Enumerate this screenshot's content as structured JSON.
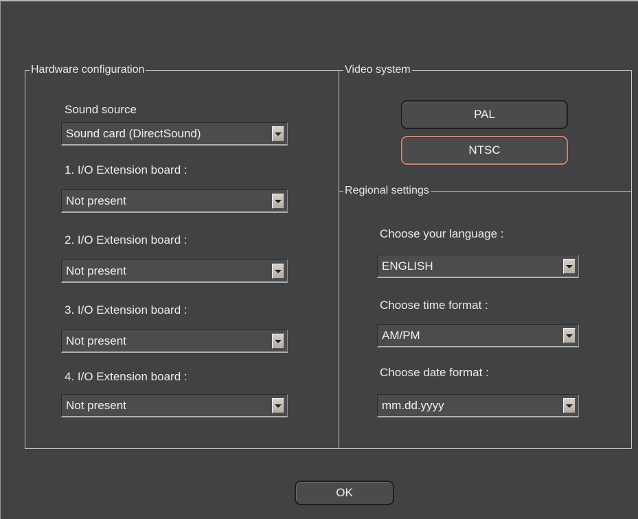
{
  "hardware": {
    "legend": "Hardware configuration",
    "sound_label": "Sound source",
    "sound_value": "Sound card (DirectSound)",
    "io_boards": [
      {
        "label": "1.  I/O Extension board :",
        "value": "Not present"
      },
      {
        "label": "2.  I/O Extension board :",
        "value": "Not present"
      },
      {
        "label": "3.  I/O Extension board :",
        "value": "Not present"
      },
      {
        "label": "4.  I/O Extension board :",
        "value": "Not present"
      }
    ]
  },
  "video": {
    "legend": "Video system",
    "options": [
      "PAL",
      "NTSC"
    ],
    "selected": "NTSC"
  },
  "regional": {
    "legend": "Regional settings",
    "language_label": "Choose your language :",
    "language_value": "ENGLISH",
    "time_label": "Choose time format :",
    "time_value": "AM/PM",
    "date_label": "Choose date format :",
    "date_value": "mm.dd.yyyy"
  },
  "footer": {
    "ok_label": "OK"
  },
  "colors": {
    "background": "#414243",
    "selected_border": "#c88a72"
  },
  "icons": {
    "combo_arrow": "chevron-down-icon"
  }
}
